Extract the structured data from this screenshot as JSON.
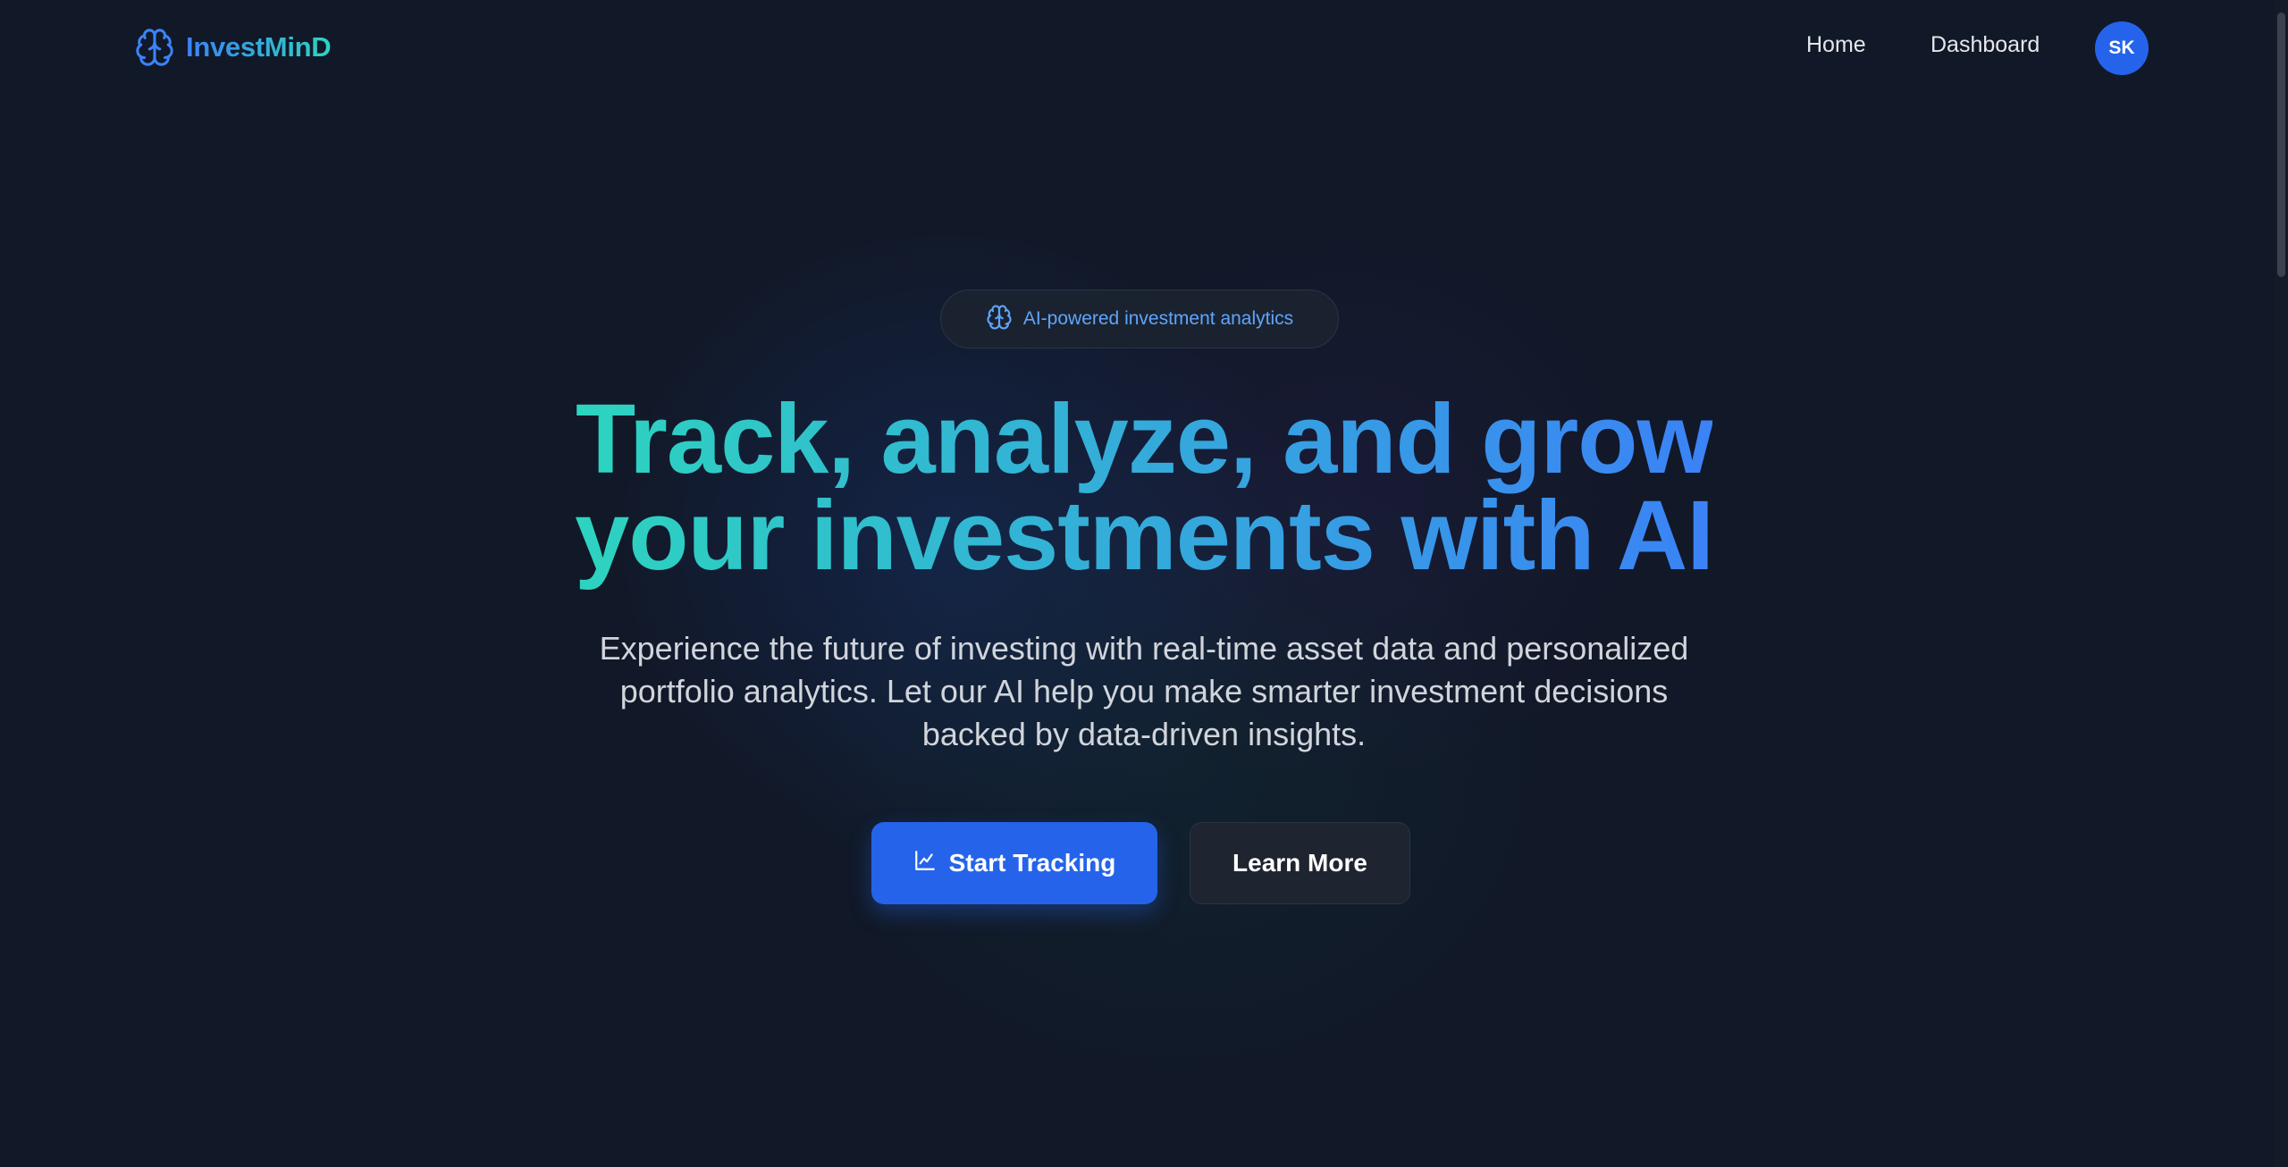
{
  "header": {
    "brand": "InvestMinD",
    "nav": [
      {
        "label": "Home"
      },
      {
        "label": "Dashboard"
      }
    ],
    "avatar_initials": "SK"
  },
  "hero": {
    "badge_text": "AI-powered investment analytics",
    "headline_lines": [
      "Track, analyze, and grow",
      "your investments with AI"
    ],
    "subtitle_lines": [
      "Experience the future of investing with real-time asset data and personalized",
      "portfolio analytics. Let our AI help you make smarter investment decisions",
      "backed by data-driven insights."
    ],
    "primary_cta": "Start Tracking",
    "secondary_cta": "Learn More"
  },
  "icons": {
    "brand": "brain-icon",
    "badge": "brain-icon",
    "primary_cta": "line-chart-icon"
  },
  "colors": {
    "background": "#111827",
    "accent_blue": "#2563eb",
    "gradient_start": "#2dd4bf",
    "gradient_end": "#3b82f6",
    "badge_text": "#60a5fa"
  }
}
